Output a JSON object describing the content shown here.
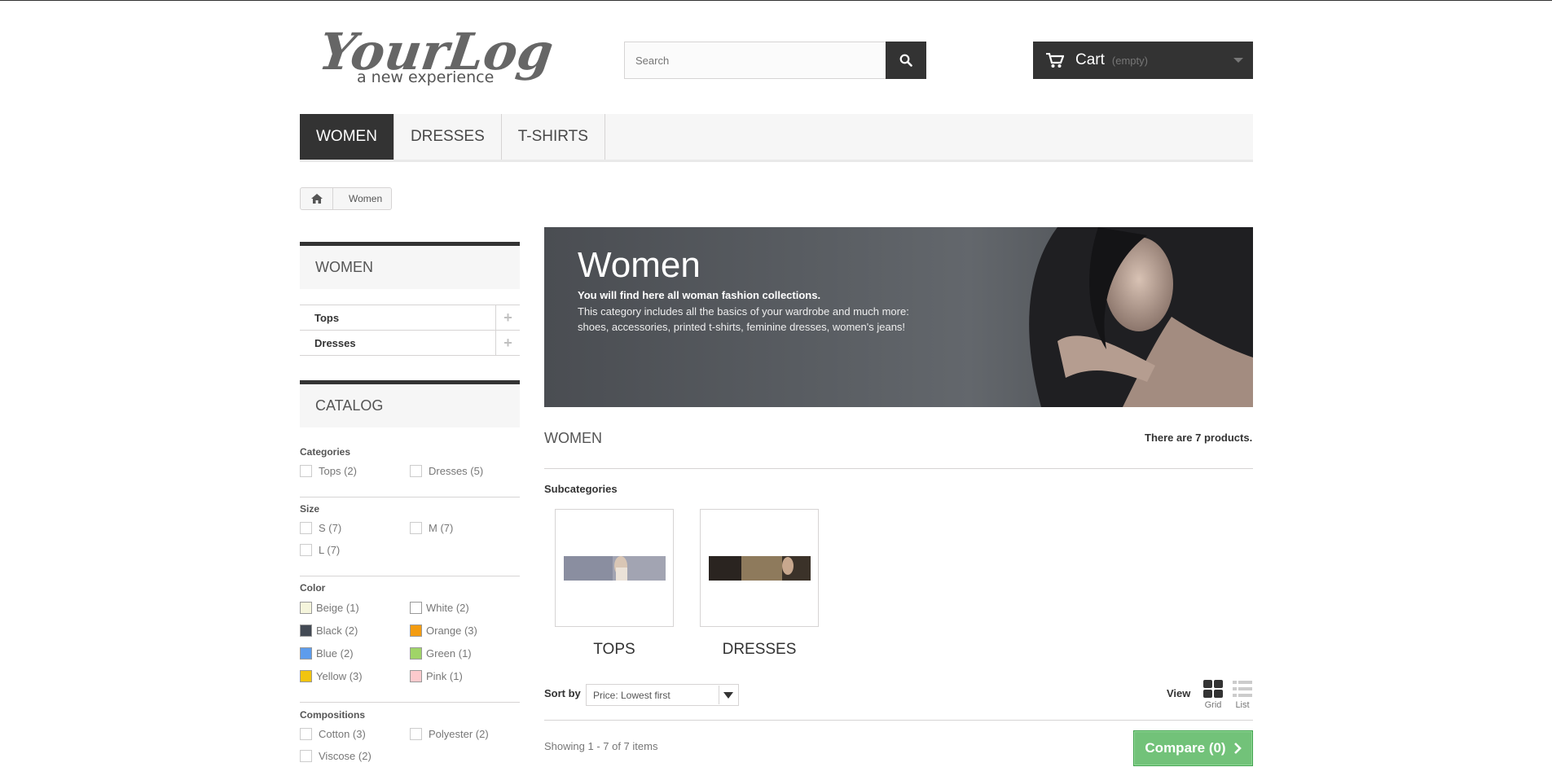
{
  "header": {
    "logo_main": "YourLogo",
    "logo_tagline": "a new experience",
    "search_placeholder": "Search",
    "cart_label": "Cart",
    "cart_status": "(empty)"
  },
  "menu": [
    {
      "label": "Women",
      "active": true
    },
    {
      "label": "Dresses",
      "active": false
    },
    {
      "label": "T-shirts",
      "active": false
    }
  ],
  "breadcrumb": {
    "current": "Women"
  },
  "sidebar": {
    "category_block": {
      "title": "Women",
      "items": [
        "Tops",
        "Dresses"
      ]
    },
    "catalog_block": {
      "title": "Catalog",
      "categories_label": "Categories",
      "categories": [
        "Tops (2)",
        "Dresses (5)"
      ],
      "size_label": "Size",
      "sizes": [
        "S (7)",
        "M (7)",
        "L (7)"
      ],
      "color_label": "Color",
      "colors": [
        {
          "label": "Beige (1)",
          "color": "#f5f5dc"
        },
        {
          "label": "White (2)",
          "color": "#ffffff"
        },
        {
          "label": "Black (2)",
          "color": "#434a54"
        },
        {
          "label": "Orange (3)",
          "color": "#f39c11"
        },
        {
          "label": "Blue (2)",
          "color": "#5d9cec"
        },
        {
          "label": "Green (1)",
          "color": "#a0d468"
        },
        {
          "label": "Yellow (3)",
          "color": "#f1c40f"
        },
        {
          "label": "Pink (1)",
          "color": "#fccacd"
        }
      ],
      "compositions_label": "Compositions",
      "compositions": [
        "Cotton (3)",
        "Polyester (2)",
        "Viscose (2)"
      ]
    }
  },
  "main": {
    "banner": {
      "title": "Women",
      "lead": "You will find here all woman fashion collections.",
      "description": "This category includes all the basics of your wardrobe and much more: shoes, accessories, printed t-shirts, feminine dresses, women's jeans!"
    },
    "page_title": "Women",
    "product_count": "There are 7 products.",
    "subcategories_label": "Subcategories",
    "subcategories": [
      "Tops",
      "Dresses"
    ],
    "sort_label": "Sort by",
    "sort_value": "Price: Lowest first",
    "view_label": "View",
    "view_grid": "Grid",
    "view_list": "List",
    "showing": "Showing 1 - 7 of 7 items",
    "compare_label": "Compare (0)"
  },
  "colors": {
    "dark": "#333333",
    "compare_green": "#72c279"
  }
}
